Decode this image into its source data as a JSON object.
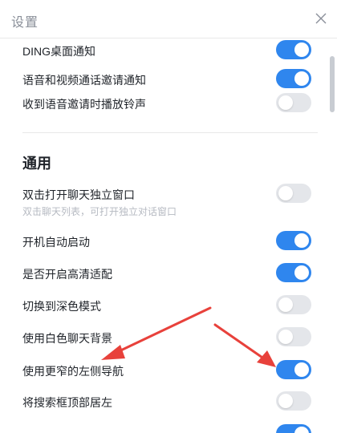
{
  "window": {
    "title": "设置"
  },
  "settings": [
    {
      "label": "DING桌面通知",
      "on": true
    },
    {
      "label": "语音和视频通话邀请通知",
      "on": true
    },
    {
      "label": "收到语音邀请时播放铃声",
      "on": false
    }
  ],
  "general": {
    "heading": "通用",
    "items": [
      {
        "label": "双击打开聊天独立窗口",
        "hint": "双击聊天列表，可打开独立对话窗口",
        "on": false
      },
      {
        "label": "开机自动启动",
        "on": true
      },
      {
        "label": "是否开启高清适配",
        "on": true
      },
      {
        "label": "切换到深色模式",
        "on": false
      },
      {
        "label": "使用白色聊天背景",
        "on": false
      },
      {
        "label": "使用更窄的左侧导航",
        "on": true
      },
      {
        "label": "将搜索框顶部居左",
        "on": false
      }
    ]
  },
  "colors": {
    "accent": "#2f86ee",
    "annotation": "#e8413b"
  }
}
